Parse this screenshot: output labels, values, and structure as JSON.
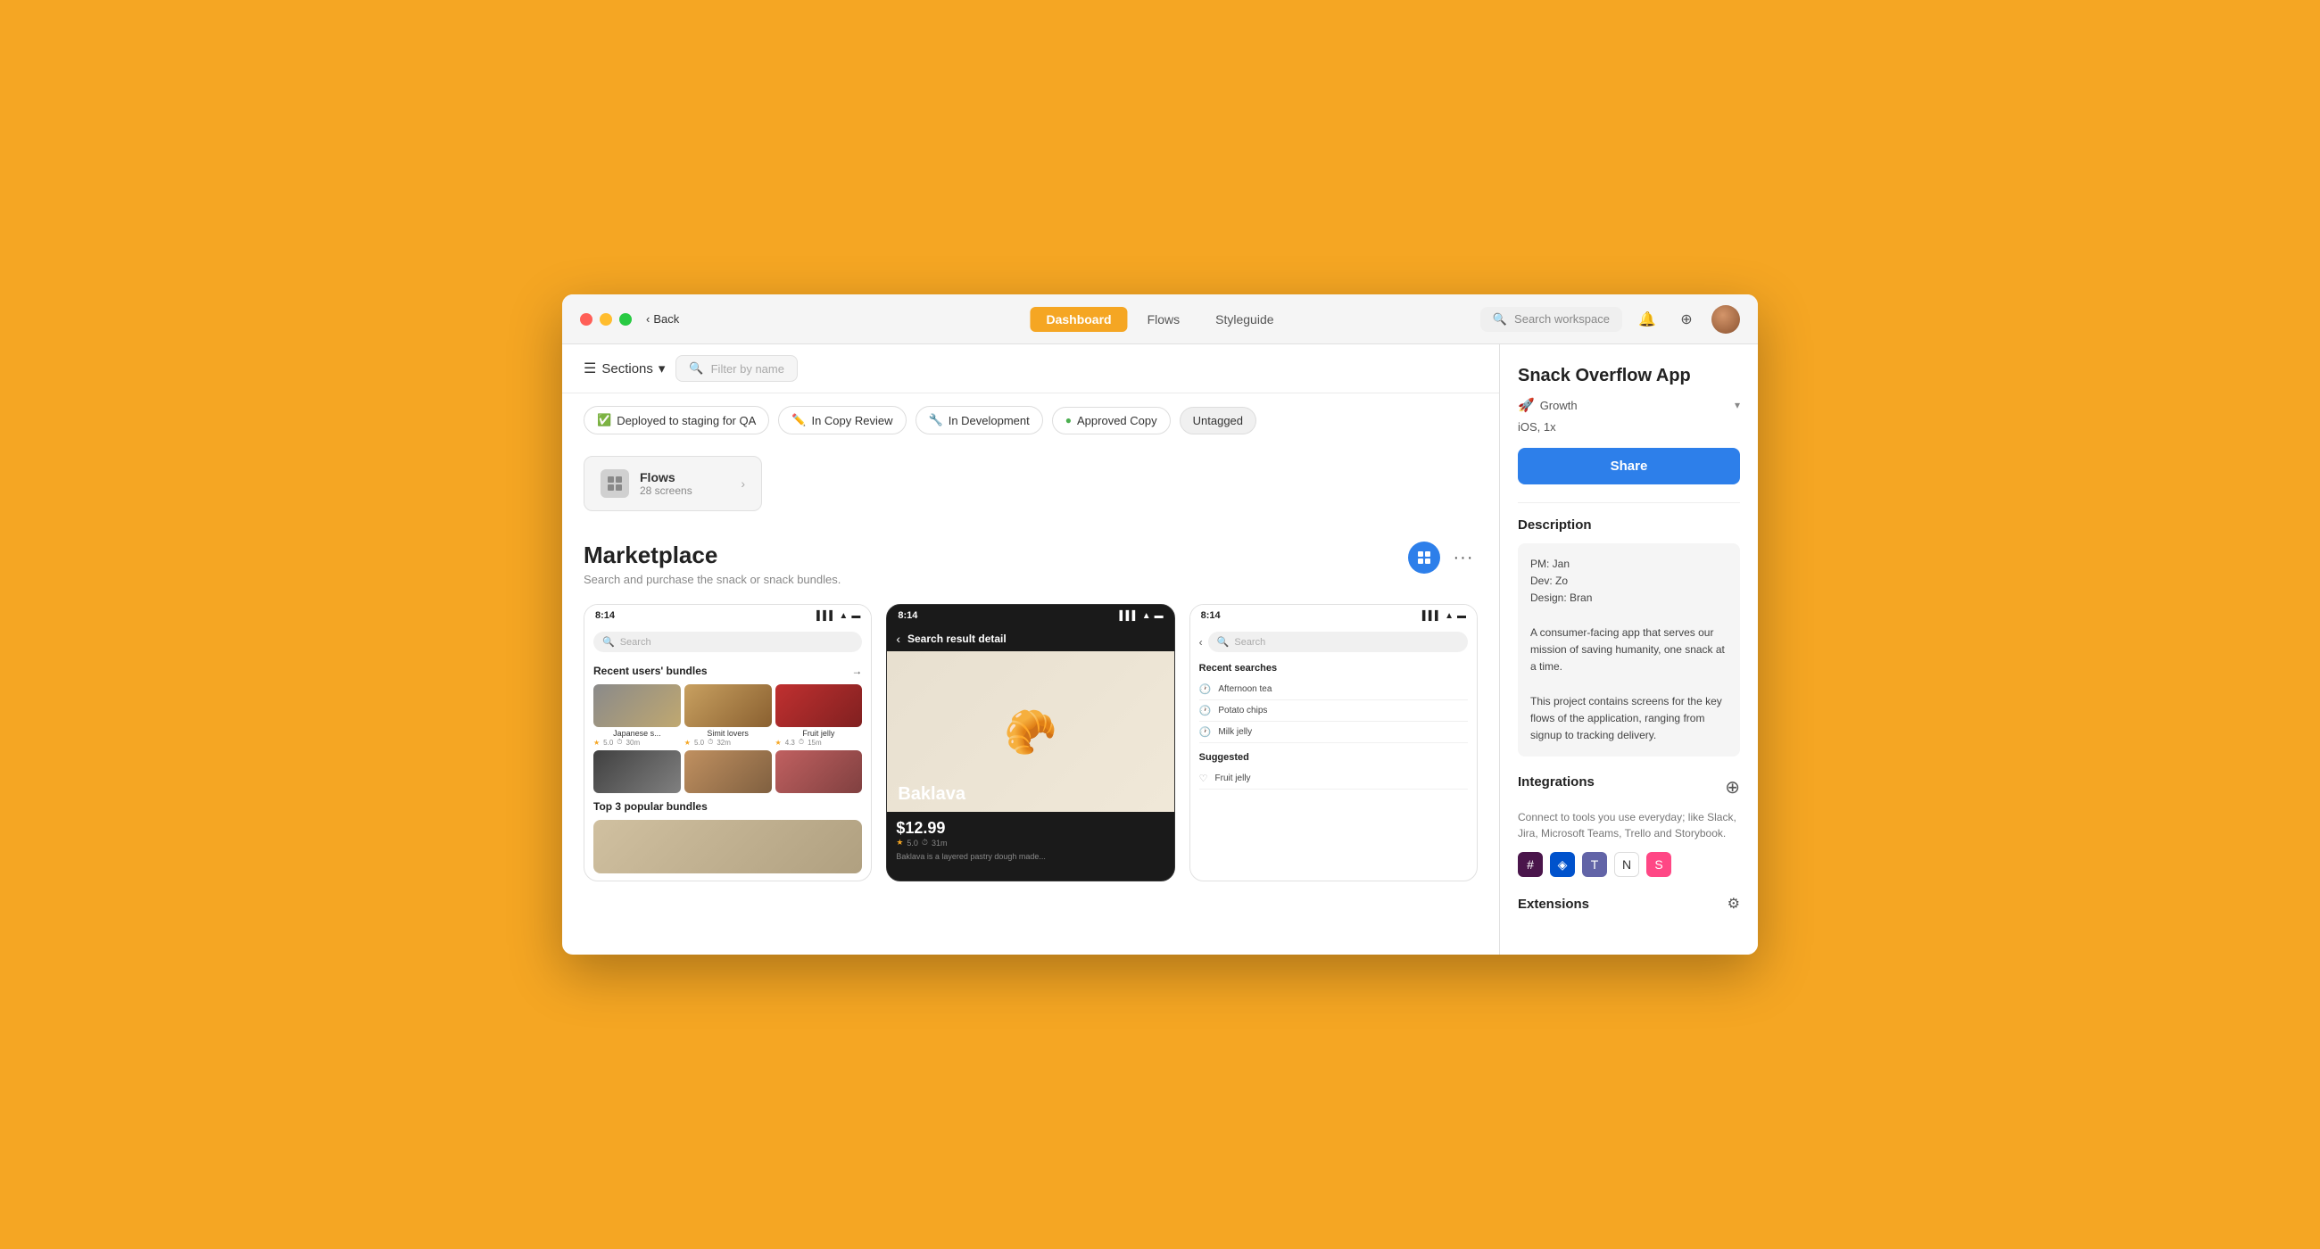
{
  "window": {
    "title": "Snack Overflow App"
  },
  "titlebar": {
    "back_label": "Back",
    "nav_tabs": [
      {
        "id": "dashboard",
        "label": "Dashboard",
        "active": true
      },
      {
        "id": "flows",
        "label": "Flows",
        "active": false
      },
      {
        "id": "styleguide",
        "label": "Styleguide",
        "active": false
      }
    ],
    "search_placeholder": "Search workspace"
  },
  "toolbar": {
    "sections_label": "Sections",
    "filter_placeholder": "Filter by name"
  },
  "tags": [
    {
      "id": "deployed",
      "emoji": "✅",
      "label": "Deployed to staging for QA"
    },
    {
      "id": "copy-review",
      "emoji": "✏️",
      "label": "In Copy Review"
    },
    {
      "id": "in-development",
      "emoji": "🔧",
      "label": "In Development"
    },
    {
      "id": "approved-copy",
      "emoji": "🟢",
      "label": "Approved Copy",
      "dot": true
    },
    {
      "id": "untagged",
      "label": "Untagged"
    }
  ],
  "flows": {
    "title": "Flows",
    "subtitle": "28 screens"
  },
  "marketplace": {
    "title": "Marketplace",
    "subtitle": "Search and purchase the snack or snack bundles."
  },
  "phones": {
    "p1": {
      "time": "8:14",
      "search_placeholder": "Search",
      "bundles_title": "Recent users' bundles",
      "items": [
        {
          "label": "Japanese s...",
          "rating": "5.0",
          "time": "30m"
        },
        {
          "label": "Simit lovers",
          "rating": "5.0",
          "time": "32m"
        },
        {
          "label": "Fruit jelly",
          "rating": "4.3",
          "time": "15m"
        }
      ],
      "popular_title": "Top 3 popular bundles"
    },
    "p2": {
      "time": "8:14",
      "nav_label": "Search result detail",
      "product_name": "Baklava",
      "price": "$12.99",
      "rating": "5.0",
      "time_label": "31m",
      "description": "Baklava is a layered pastry dough made..."
    },
    "p3": {
      "time": "8:14",
      "search_placeholder": "Search",
      "recent_title": "Recent searches",
      "recent_items": [
        "Afternoon tea",
        "Potato chips",
        "Milk jelly"
      ],
      "suggested_title": "Suggested",
      "suggested_items": [
        "Fruit jelly"
      ]
    }
  },
  "sidebar": {
    "app_title": "Snack Overflow App",
    "tag_emoji": "🚀",
    "tag_label": "Growth",
    "meta": "iOS, 1x",
    "share_label": "Share",
    "description_label": "Description",
    "description_text": "PM: Jan\nDev: Zo\nDesign: Bran\n\nA consumer-facing app that serves our mission of saving humanity, one snack at a time.\n\nThis project contains screens for the key flows of the application, ranging from signup to tracking delivery.",
    "integrations_label": "Integrations",
    "integrations_text": "Connect to tools you use everyday; like Slack, Jira, Microsoft Teams, Trello and Storybook.",
    "extensions_label": "Extensions"
  }
}
